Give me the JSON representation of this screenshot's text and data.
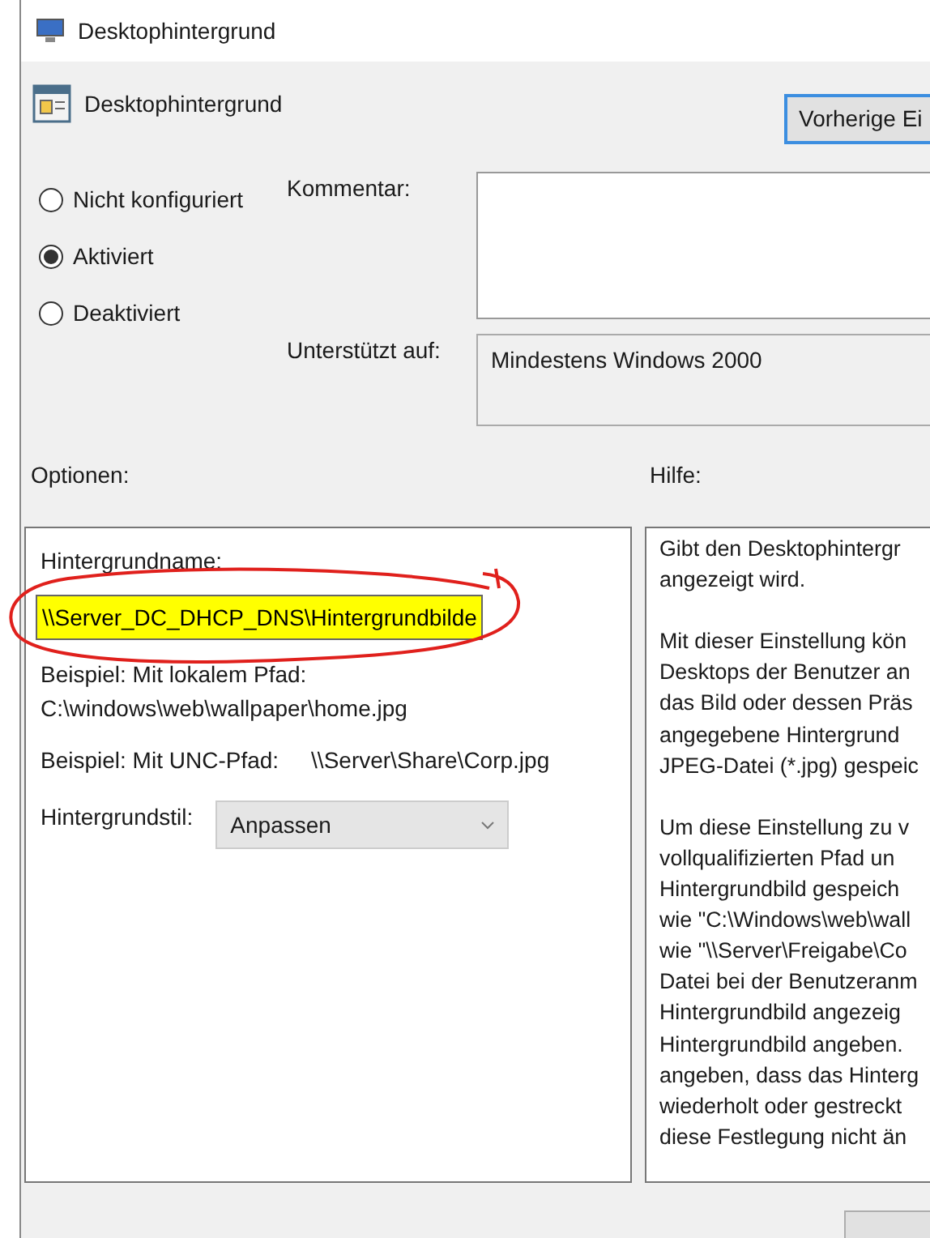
{
  "window": {
    "title": "Desktophintergrund"
  },
  "header": {
    "title": "Desktophintergrund",
    "previous_button": "Vorherige Ei"
  },
  "state_options": [
    {
      "label": "Nicht konfiguriert",
      "selected": false
    },
    {
      "label": "Aktiviert",
      "selected": true
    },
    {
      "label": "Deaktiviert",
      "selected": false
    }
  ],
  "comment": {
    "label": "Kommentar:"
  },
  "supported": {
    "label": "Unterstützt auf:",
    "value": "Mindestens Windows 2000"
  },
  "options": {
    "heading": "Optionen:",
    "name_label": "Hintergrundname:",
    "name_value": "\\\\Server_DC_DHCP_DNS\\Hintergrundbilde",
    "name_highlighted": true,
    "name_circled": true,
    "local_example": [
      "Beispiel: Mit lokalem Pfad:",
      "C:\\windows\\web\\wallpaper\\home.jpg"
    ],
    "unc_example": {
      "label": "Beispiel: Mit UNC-Pfad:",
      "path": "\\\\Server\\Share\\Corp.jpg"
    },
    "style_label": "Hintergrundstil:",
    "style_value": "Anpassen"
  },
  "help": {
    "heading": "Hilfe:",
    "paragraphs": [
      [
        "Gibt den Desktophintergr",
        "angezeigt wird."
      ],
      [
        "Mit dieser Einstellung kön",
        "Desktops der Benutzer an",
        "das Bild oder dessen Präs",
        "angegebene Hintergrund",
        "JPEG-Datei (*.jpg) gespeic"
      ],
      [
        "Um diese Einstellung zu v",
        "vollqualifizierten Pfad un",
        "Hintergrundbild gespeich",
        "wie \"C:\\Windows\\web\\wall",
        "wie \"\\\\Server\\Freigabe\\Co",
        "Datei bei der Benutzeranm",
        "Hintergrundbild angezeig",
        "Hintergrundbild angeben.",
        "angeben, dass das Hinterg",
        "wiederholt oder gestreckt",
        "diese Festlegung nicht än"
      ]
    ]
  }
}
